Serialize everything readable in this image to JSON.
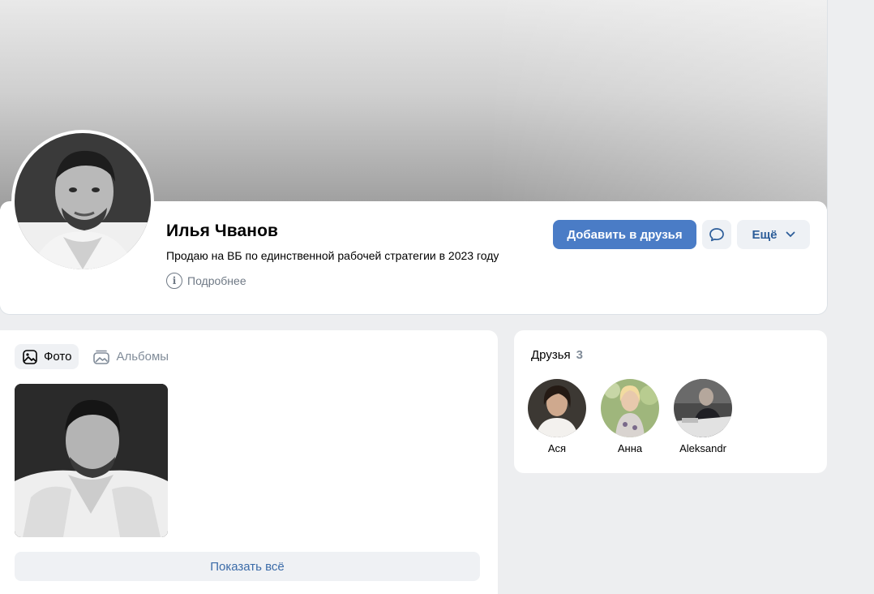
{
  "profile": {
    "name": "Илья Чванов",
    "status": "Продаю на ВБ по единственной рабочей стратегии в 2023 году",
    "more_info": "Подробнее"
  },
  "actions": {
    "add_friend": "Добавить в друзья",
    "more": "Ещё"
  },
  "photos": {
    "tabs": [
      {
        "label": "Фото",
        "active": true
      },
      {
        "label": "Альбомы",
        "active": false
      }
    ],
    "show_all": "Показать всё"
  },
  "friends": {
    "title": "Друзья",
    "count": "3",
    "items": [
      {
        "name": "Ася"
      },
      {
        "name": "Анна"
      },
      {
        "name": "Aleksandr"
      }
    ]
  },
  "colors": {
    "primary_button": "#4a7cc6",
    "link": "#3b6ba8",
    "page_bg": "#edeef0"
  }
}
